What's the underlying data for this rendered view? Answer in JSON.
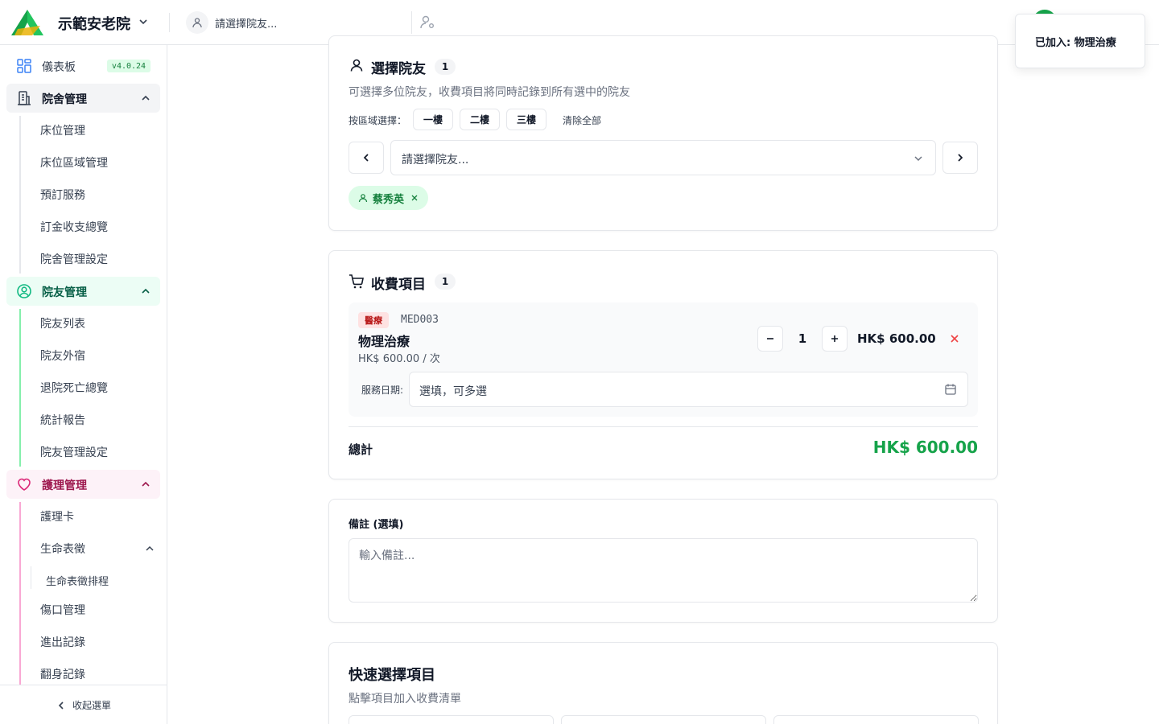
{
  "header": {
    "org_name": "示範安老院",
    "resident_selector_placeholder": "請選擇院友..."
  },
  "toast": {
    "message": "已加入: 物理治療"
  },
  "sidebar": {
    "dashboard": {
      "label": "儀表板",
      "version": "v4.0.24"
    },
    "facility": {
      "label": "院舍管理",
      "items": [
        "床位管理",
        "床位區域管理",
        "預訂服務",
        "訂金收支總覽",
        "院舍管理設定"
      ]
    },
    "resident": {
      "label": "院友管理",
      "items": [
        "院友列表",
        "院友外宿",
        "退院死亡總覽",
        "統計報告",
        "院友管理設定"
      ]
    },
    "nursing": {
      "label": "護理管理",
      "items": [
        "護理卡",
        "生命表徵",
        "生命表徵排程",
        "傷口管理",
        "進出記錄",
        "翻身記錄"
      ]
    },
    "collapse_label": "收起選單"
  },
  "select_residents": {
    "title": "選擇院友",
    "count": "1",
    "description": "可選擇多位院友，收費項目將同時記錄到所有選中的院友",
    "area_label": "按區域選擇：",
    "areas": [
      "一樓",
      "二樓",
      "三樓"
    ],
    "clear_all": "清除全部",
    "dropdown_placeholder": "請選擇院友...",
    "selected": [
      {
        "name": "蔡秀英"
      }
    ]
  },
  "charge_items": {
    "title": "收費項目",
    "count": "1",
    "items": [
      {
        "category": "醫療",
        "code": "MED003",
        "name": "物理治療",
        "unit_price": "HK$ 600.00 / 次",
        "quantity": "1",
        "line_total": "HK$ 600.00",
        "service_date_label": "服務日期:",
        "service_date_placeholder": "選填，可多選"
      }
    ],
    "total_label": "總計",
    "total_value": "HK$ 600.00"
  },
  "notes": {
    "label": "備註 (選填)",
    "placeholder": "輸入備註..."
  },
  "quick_select": {
    "title": "快速選擇項目",
    "subtitle": "點擊項目加入收費清單"
  },
  "colors": {
    "brand_green": "#16a34a",
    "resident_accent": "#10b981",
    "nursing_accent": "#db2777",
    "danger": "#ef4444"
  }
}
